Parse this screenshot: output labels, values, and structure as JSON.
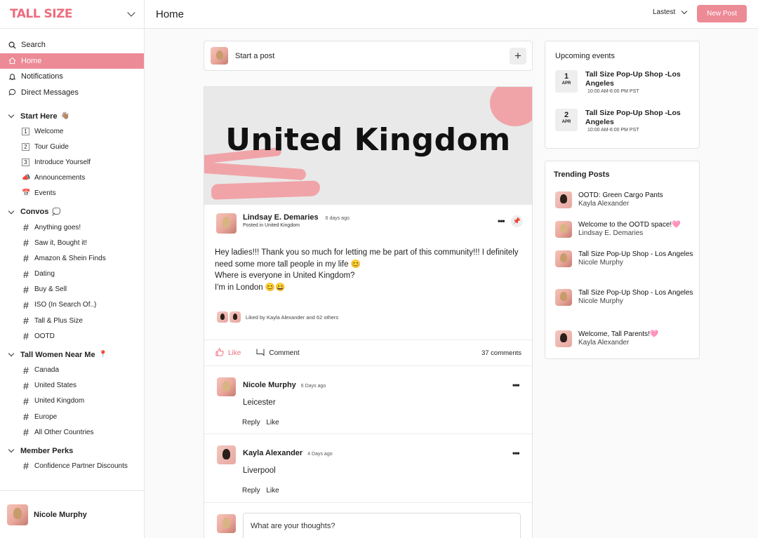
{
  "brand": {
    "logo": "TALL SIZE"
  },
  "header": {
    "title": "Home",
    "sort": "Lastest",
    "new_post": "New Post"
  },
  "sidebar": {
    "top": [
      {
        "label": "Search",
        "icon": "search-icon"
      },
      {
        "label": "Home",
        "icon": "home-icon"
      },
      {
        "label": "Notifications",
        "icon": "bell-icon"
      },
      {
        "label": "Direct Messages",
        "icon": "chat-icon"
      }
    ],
    "sections": {
      "start": {
        "title": "Start Here",
        "emoji": "👋🏽",
        "items": [
          "Welcome",
          "Tour Guide",
          "Introduce Yourself",
          "Announcements",
          "Events"
        ]
      },
      "convos": {
        "title": "Convos",
        "emoji": "💭",
        "items": [
          "Anything goes!",
          "Saw it, Bought it!",
          "Amazon & Shein Finds",
          "Dating",
          "Buy & Sell",
          "ISO (In Search Of..)",
          "Tall & Plus Size",
          "OOTD"
        ]
      },
      "near": {
        "title": "Tall Women Near Me",
        "emoji": "📍",
        "items": [
          "Canada",
          "United States",
          "United Kingdom",
          "Europe",
          "All Other Countries"
        ]
      },
      "perks": {
        "title": "Member Perks",
        "items": [
          "Confidence Partner Discounts"
        ]
      }
    },
    "user": "Nicole Murphy"
  },
  "composer": {
    "label": "Start a post",
    "plus": "+"
  },
  "post": {
    "banner": "United Kingdom",
    "author": "Lindsay E. Demaries",
    "time": "6 days ago",
    "posted_in": "Posted in United Kingdom",
    "body": [
      "Hey ladies!!! Thank you so much for letting me be part of this community!!! I definitely need some more tall people in my life 😊",
      "Where is everyone in United Kingdom?",
      "I'm in London 😊😄"
    ],
    "liked_by": "Liked by Kayla Alexander and 62 others",
    "like": "Like",
    "comment": "Comment",
    "comments_count": "37 comments"
  },
  "comments": [
    {
      "name": "Nicole Murphy",
      "time": "6 Days ago",
      "text": "Leicester",
      "reply": "Reply",
      "like": "Like"
    },
    {
      "name": "Kayla Alexander",
      "time": "4 Days ago",
      "text": "Liverpool",
      "reply": "Reply",
      "like": "Like"
    }
  ],
  "reply_placeholder": "What are your thoughts?",
  "events": {
    "title": "Upcoming events",
    "items": [
      {
        "day": "1",
        "month": "APR",
        "title": "Tall Size Pop-Up Shop -Los Angeles",
        "time": "10:00 AM-6:00 PM PST"
      },
      {
        "day": "2",
        "month": "APR",
        "title": "Tall Size Pop-Up Shop -Los Angeles",
        "time": "10:00 AM-6:00 PM PST"
      }
    ]
  },
  "trending": {
    "title": "Trending Posts",
    "items": [
      {
        "title": "OOTD: Green Cargo Pants",
        "author": "Kayla Alexander"
      },
      {
        "title": "Welcome to the OOTD space!🩷",
        "author": "Lindsay E. Demaries"
      },
      {
        "title": "Tall Size Pop-Up Shop - Los Angeles",
        "author": "Nicole Murphy"
      },
      {
        "title": "Tall Size Pop-Up Shop - Los Angeles",
        "author": "Nicole Murphy"
      },
      {
        "title": "Welcome, Tall Parents!🩷",
        "author": "Kayla Alexander"
      }
    ]
  },
  "colors": {
    "accent": "#ec8a96",
    "brand": "#ec6d7e"
  }
}
